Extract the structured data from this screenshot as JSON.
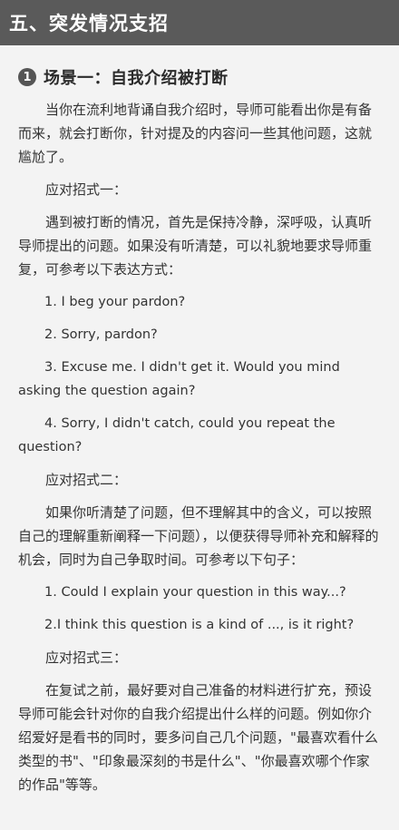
{
  "header": {
    "title": "五、突发情况支招"
  },
  "scene": {
    "number": "1",
    "title": "场景一：自我介绍被打断"
  },
  "paragraphs": [
    "当你在流利地背诵自我介绍时，导师可能看出你是有备而来，就会打断你，针对提及的内容问一些其他问题，这就尴尬了。",
    "应对招式一：",
    "遇到被打断的情况，首先是保持冷静，深呼吸，认真听导师提出的问题。如果没有听清楚，可以礼貌地要求导师重复，可参考以下表达方式：",
    "1. I beg your pardon?",
    "2. Sorry, pardon?",
    "3. Excuse me. I didn't get it. Would you mind asking the question again?",
    "4. Sorry, I didn't catch, could you repeat the question?",
    "应对招式二：",
    "如果你听清楚了问题，但不理解其中的含义，可以按照自己的理解重新阐释一下问题），以便获得导师补充和解释的机会，同时为自己争取时间。可参考以下句子：",
    "1. Could I explain your question in this way...?",
    "2.I think this question is a kind of ..., is it right?",
    "应对招式三：",
    "在复试之前，最好要对自己准备的材料进行扩充，预设导师可能会针对你的自我介绍提出什么样的问题。例如你介绍爱好是看书的同时，要多问自己几个问题，\"最喜欢看什么类型的书\"、\"印象最深刻的书是什么\"、\"你最喜欢哪个作家的作品\"等等。"
  ]
}
